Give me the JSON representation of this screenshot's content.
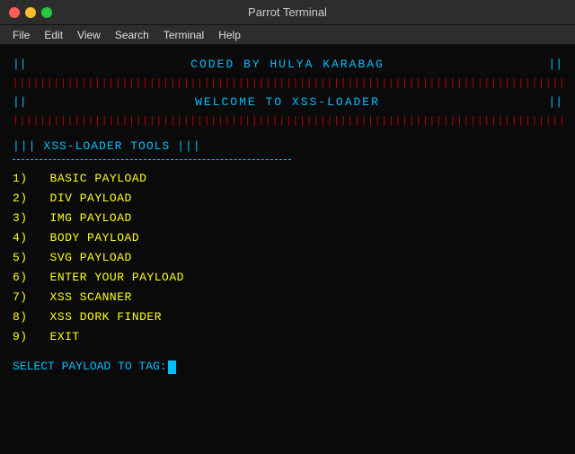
{
  "titlebar": {
    "title": "Parrot Terminal"
  },
  "menubar": {
    "items": [
      "File",
      "Edit",
      "View",
      "Search",
      "Terminal",
      "Help"
    ]
  },
  "terminal": {
    "header1_pipes": "||",
    "header1_text": "CODED  BY  HULYA   KARABAG",
    "header1_pipes_right": "||",
    "red_bars": "|||||||||||||||||||||||||||||||||||||||||||||||||||||||||||||||||||||||||||||||||||||||||||||||||||||||||||||||||||||||||||",
    "welcome_pipes_left": "||",
    "welcome_text": "WELCOME TO XSS-LOADER",
    "welcome_pipes_right": "||",
    "red_bars2": "|||||||||||||||||||||||||||||||||||||||||||||||||||||||||||||||||||||||||||||||||||||||||||||||||||||||||||||||||||||||||||",
    "tools_pipes_left": "|||",
    "tools_label": "XSS-LOADER TOOLS",
    "tools_pipes_right": "|||",
    "menu_items": [
      {
        "num": "1)",
        "label": "BASIC PAYLOAD"
      },
      {
        "num": "2)",
        "label": "DIV PAYLOAD"
      },
      {
        "num": "3)",
        "label": "IMG PAYLOAD"
      },
      {
        "num": "4)",
        "label": "BODY PAYLOAD"
      },
      {
        "num": "5)",
        "label": "SVG PAYLOAD"
      },
      {
        "num": "6)",
        "label": "ENTER YOUR PAYLOAD"
      },
      {
        "num": "7)",
        "label": "XSS SCANNER"
      },
      {
        "num": "8)",
        "label": "XSS DORK FINDER"
      },
      {
        "num": "9)",
        "label": "EXIT"
      }
    ],
    "prompt": "SELECT PAYLOAD TO TAG:"
  }
}
